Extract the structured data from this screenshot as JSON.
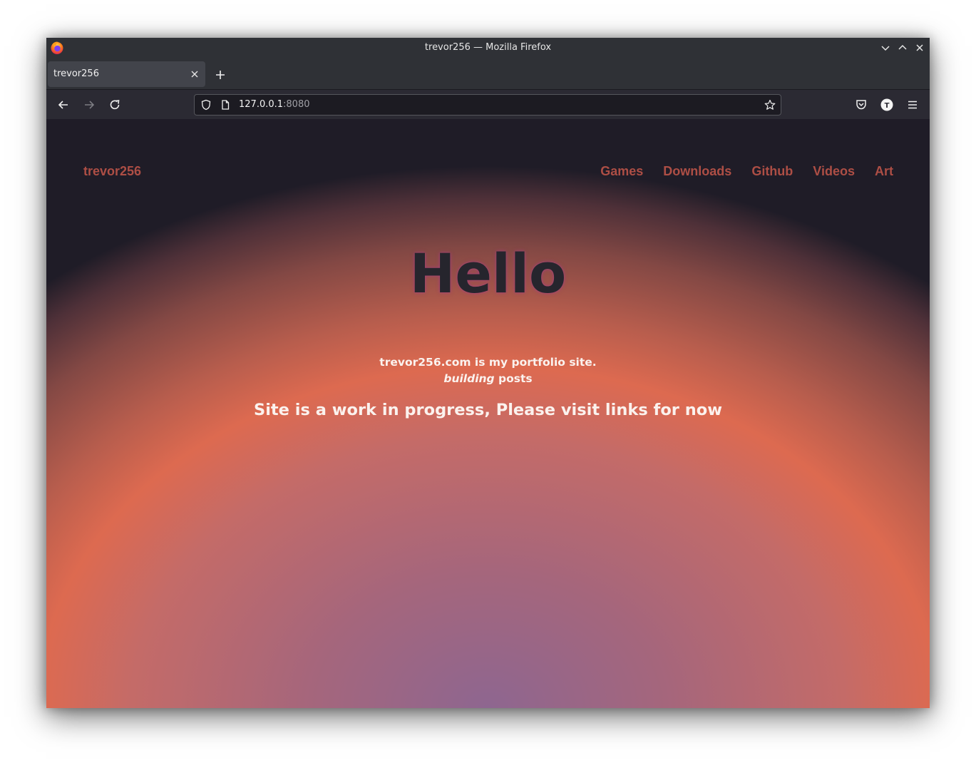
{
  "window": {
    "title": "trevor256 — Mozilla Firefox"
  },
  "tabs": [
    {
      "label": "trevor256",
      "active": true
    }
  ],
  "toolbar": {
    "url_host": "127.0.0.1",
    "url_port": ":8080"
  },
  "site": {
    "logo": "trevor256",
    "nav": [
      "Games",
      "Downloads",
      "Github",
      "Videos",
      "Art"
    ],
    "hero_title": "Hello",
    "tagline_line1": "trevor256.com is my portfolio site.",
    "tagline_line2_em": "building",
    "tagline_line2_rest": " posts",
    "notice": "Site is a work in progress, Please visit links for now"
  },
  "account_avatar_letter": "T",
  "colors": {
    "nav_link": "#ad4e45",
    "hero_text": "#26252d",
    "body_text": "#fbf2ee"
  }
}
